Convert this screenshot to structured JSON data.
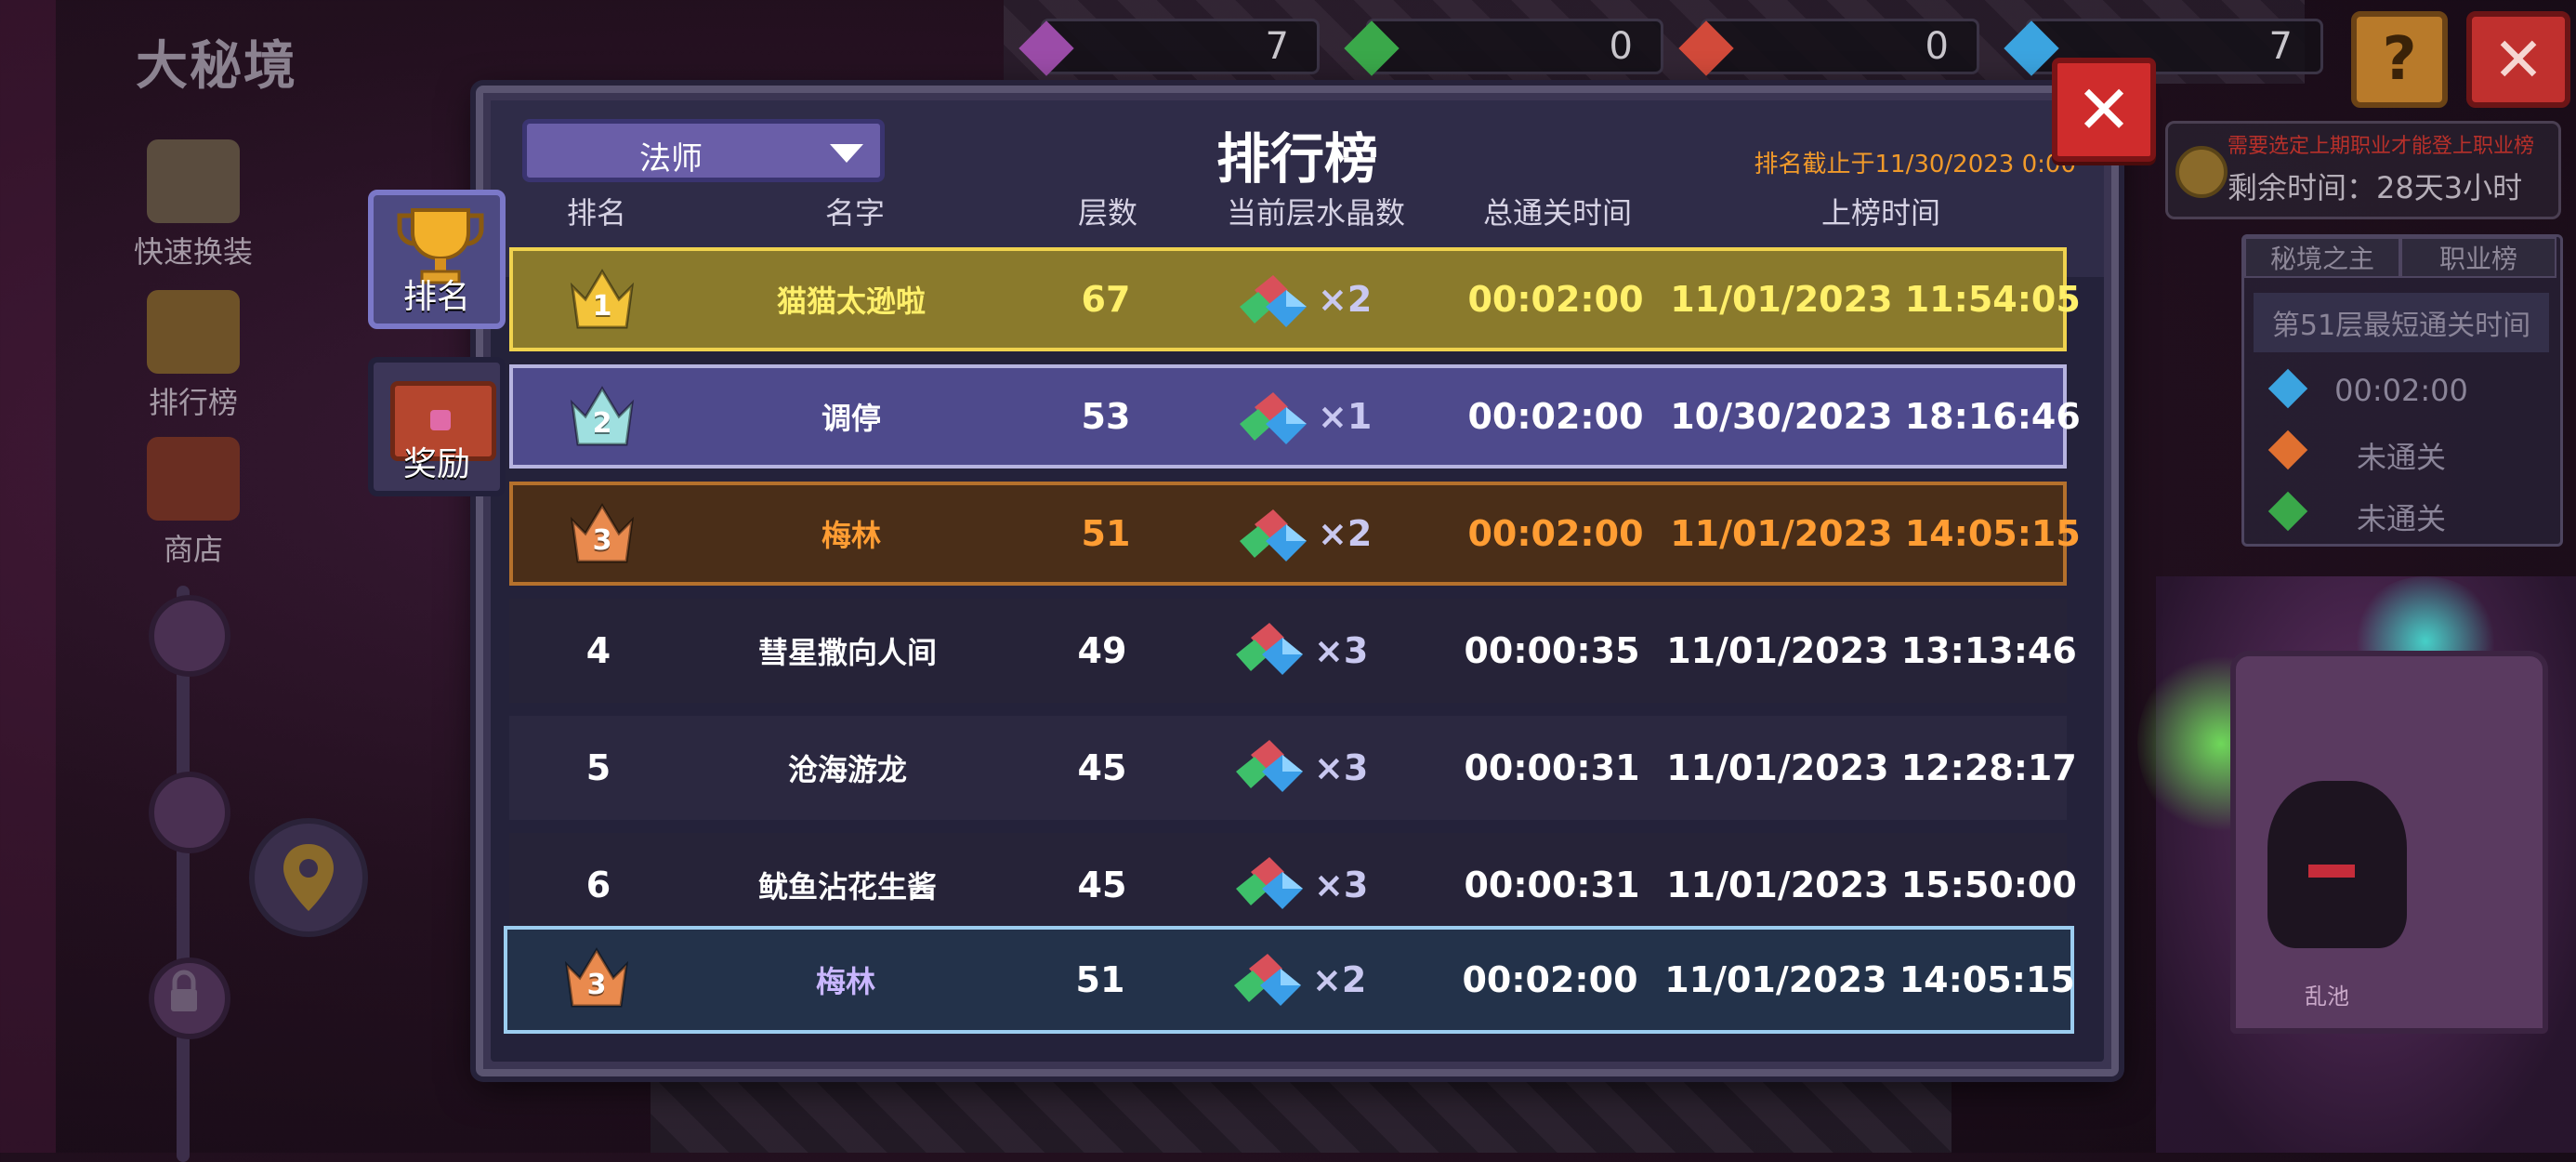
{
  "game_title": "大秘境",
  "top_counters": [
    "7",
    "0",
    "0",
    "7"
  ],
  "left_menu": [
    {
      "label": "快速换装",
      "icon": "armor-icon"
    },
    {
      "label": "排行榜",
      "icon": "trophy-icon"
    },
    {
      "label": "商店",
      "icon": "shop-icon"
    }
  ],
  "timer": {
    "warning": "需要选定上期职业才能登上职业榜",
    "remaining": "剩余时间：28天3小时"
  },
  "side_panel": {
    "tabs": [
      "秘境之主",
      "职业榜"
    ],
    "subtitle": "第51层最短通关时间",
    "rows": [
      {
        "gem": "#3ba4e0",
        "value": "00:02:00"
      },
      {
        "gem": "#e07030",
        "value": "未通关"
      },
      {
        "gem": "#3aa84a",
        "value": "未通关"
      }
    ]
  },
  "boss_label": "乱池",
  "modal": {
    "class_select": "法师",
    "title": "排行榜",
    "deadline": "排名截止于11/30/2023 0:00",
    "columns": [
      "排名",
      "名字",
      "层数",
      "当前层水晶数",
      "总通关时间",
      "上榜时间"
    ]
  },
  "side_tabs": [
    {
      "label": "排名",
      "active": true
    },
    {
      "label": "奖励",
      "active": false
    }
  ],
  "rows": [
    {
      "rank": "1",
      "name": "猫猫太逊啦",
      "floor": "67",
      "crystals": "×2",
      "total_time": "00:02:00",
      "listed": "11/01/2023 11:54:05"
    },
    {
      "rank": "2",
      "name": "调停",
      "floor": "53",
      "crystals": "×1",
      "total_time": "00:02:00",
      "listed": "10/30/2023 18:16:46"
    },
    {
      "rank": "3",
      "name": "梅林",
      "floor": "51",
      "crystals": "×2",
      "total_time": "00:02:00",
      "listed": "11/01/2023 14:05:15"
    },
    {
      "rank": "4",
      "name": "彗星撒向人间",
      "floor": "49",
      "crystals": "×3",
      "total_time": "00:00:35",
      "listed": "11/01/2023 13:13:46"
    },
    {
      "rank": "5",
      "name": "沧海游龙",
      "floor": "45",
      "crystals": "×3",
      "total_time": "00:00:31",
      "listed": "11/01/2023 12:28:17"
    },
    {
      "rank": "6",
      "name": "鱿鱼沾花生酱",
      "floor": "45",
      "crystals": "×3",
      "total_time": "00:00:31",
      "listed": "11/01/2023 15:50:00"
    }
  ],
  "my_row": {
    "rank": "3",
    "name": "梅林",
    "floor": "51",
    "crystals": "×2",
    "total_time": "00:02:00",
    "listed": "11/01/2023 14:05:15"
  },
  "colors": {
    "gold_text": "#fff06a",
    "bronze_text": "#ff9d33",
    "silver_text": "#ffffff",
    "me_name": "#c9b6ff",
    "crown_gold": "#f3c43a",
    "crown_silver": "#9fe0e0",
    "crown_bronze": "#e98a4e"
  }
}
